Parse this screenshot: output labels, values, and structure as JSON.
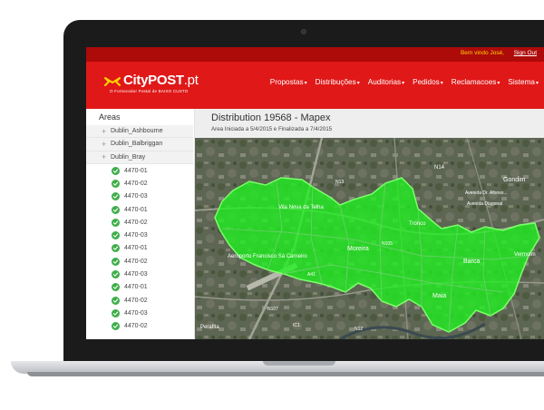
{
  "topbar": {
    "greeting": "Bem vindo José,",
    "signout": "Sign Out"
  },
  "header": {
    "logo_main": "CityPOST",
    "logo_suffix": ".pt",
    "tagline": "O Fornecedor Postal de BAIXO CUSTO",
    "nav": [
      "Propostas",
      "Distribuções",
      "Auditorias",
      "Pedidos",
      "Reclamacoes",
      "Sistema"
    ],
    "nav_caret": "▾"
  },
  "sidebar": {
    "title": "Areas",
    "groups": [
      "Dublin_Ashbourne",
      "Dublin_Balbriggan",
      "Dublin_Bray"
    ],
    "group_toggle": "+",
    "leaves": [
      "4470-01",
      "4470-02",
      "4470-03",
      "4470-01",
      "4470-02",
      "4470-03",
      "4470-01",
      "4470-02",
      "4470-03",
      "4470-01",
      "4470-02",
      "4470-03",
      "4470-02"
    ]
  },
  "main": {
    "title": "Distribution 19568 - Mapex",
    "subtitle": "Area Iniciada   a 5/4/2015 e Finalizada a 7/4/2015"
  },
  "map": {
    "labels": [
      "N14",
      "N13",
      "Gondim",
      "Vila Nova da Telha",
      "Avenida Dr. Afonso...",
      "Avenida Diagonal",
      "Tronco",
      "Moreira",
      "N105",
      "Barca",
      "Vermoim",
      "Aeroporto Francisco Sá Carneiro",
      "A41",
      "Maia",
      "N107",
      "Perafita",
      "IC1",
      "N12"
    ],
    "coverage_color": "#1ff21f",
    "coverage_edge": "#7cff6a"
  },
  "colors": {
    "brand_red": "#e01818",
    "topbar_red": "#ad0a0a",
    "check_green": "#3fae49",
    "greeting_yellow": "#ffd400"
  }
}
